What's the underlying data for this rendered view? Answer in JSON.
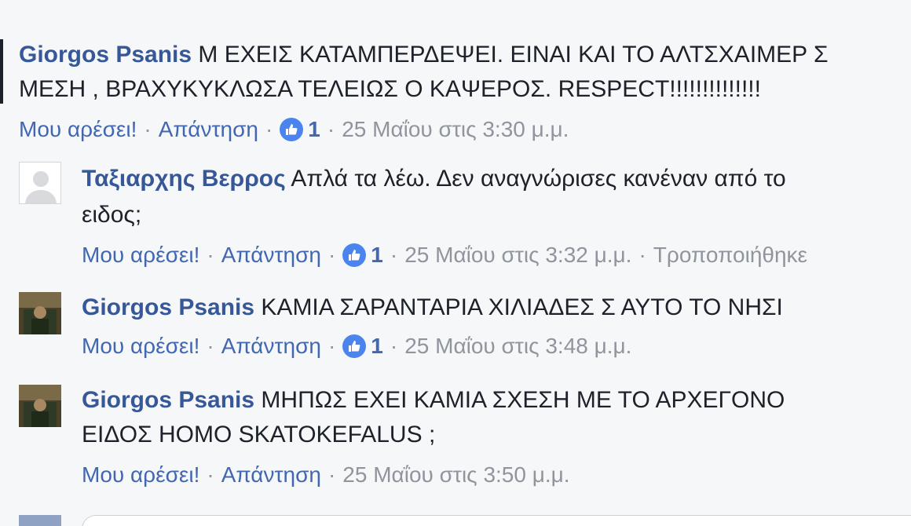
{
  "comments": [
    {
      "author": "Giorgos Psanis",
      "text_line1": "Μ ΕΧΕΙΣ ΚΑΤΑΜΠΕΡΔΕΨΕΙ. ΕΙΝΑΙ ΚΑΙ ΤΟ ΑΛΤΣΧΑΙΜΕΡ Σ",
      "text_line2": "ΜΕΣΗ , ΒΡΑΧΥΚΥΚΛΩΣΑ ΤΕΛΕΙΩΣ Ο ΚΑΨΕΡΟΣ. RESPECT!!!!!!!!!!!!!!",
      "like_label": "Μου αρέσει!",
      "reply_label": "Απάντηση",
      "like_count": "1",
      "timestamp": "25 Μαΐου στις 3:30 μ.μ."
    },
    {
      "author": "Ταξιαρχης Βερρος",
      "text_line1": "Απλά τα λέω. Δεν αναγνώρισες κανέναν από το",
      "text_line2": "ειδος;",
      "like_label": "Μου αρέσει!",
      "reply_label": "Απάντηση",
      "like_count": "1",
      "timestamp": "25 Μαΐου στις 3:32 μ.μ.",
      "edited_label": "Τροποποιήθηκε"
    },
    {
      "author": "Giorgos Psanis",
      "text_line1": "ΚΑΜΙΑ ΣΑΡΑΝΤΑΡΙΑ ΧΙΛΙΑΔΕΣ Σ ΑΥΤΟ ΤΟ ΝΗΣΙ",
      "like_label": "Μου αρέσει!",
      "reply_label": "Απάντηση",
      "like_count": "1",
      "timestamp": "25 Μαΐου στις 3:48 μ.μ."
    },
    {
      "author": "Giorgos Psanis",
      "text_line1": "ΜΗΠΩΣ ΕΧΕΙ ΚΑΜΙΑ ΣΧΕΣΗ ΜΕ ΤΟ ΑΡΧΕΓΟΝΟ",
      "text_line2": "ΕΙΔΟΣ HOMO SKATOKEFALUS ;",
      "like_label": "Μου αρέσει!",
      "reply_label": "Απάντηση",
      "timestamp": "25 Μαΐου στις 3:50 μ.μ."
    }
  ],
  "colors": {
    "author": "#365899",
    "link": "#4267b2",
    "meta": "#90949c",
    "text": "#1d2129",
    "like_badge": "#4a84ec",
    "background": "#f6f7f9"
  },
  "icons": {
    "like_badge": "thumbs-up-icon"
  }
}
